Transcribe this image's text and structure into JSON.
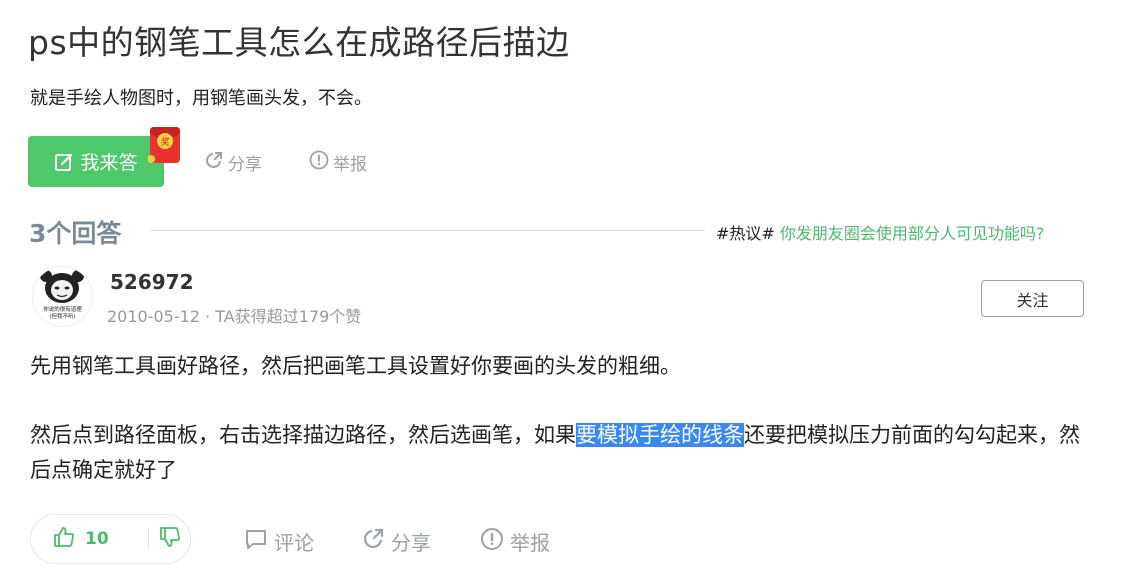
{
  "question": {
    "title": "ps中的钢笔工具怎么在成路径后描边",
    "description": "就是手绘人物图时，用钢笔画头发，不会。",
    "answer_button": "我来答",
    "share": "分享",
    "report": "举报",
    "redpack_char": "奖"
  },
  "answers_header": {
    "count": "3个回答",
    "hot_tag": "#热议#",
    "hot_link": "你发朋友圈会使用部分人可见功能吗?"
  },
  "answer": {
    "username": "526972",
    "meta": "2010-05-12 · TA获得超过179个赞",
    "avatar_caption_1": "你说的很有道理",
    "avatar_caption_2": "(但我不听)",
    "follow": "关注",
    "para1": "先用钢笔工具画好路径，然后把画笔工具设置好你要画的头发的粗细。",
    "para2_before": "然后点到路径面板，右击选择描边路径，然后选画笔，如果",
    "para2_highlight": "要模拟手绘的线条",
    "para2_after": "还要把模拟压力前面的勾勾起来，然后点确定就好了",
    "likes": "10",
    "comment": "评论",
    "share": "分享",
    "report": "举报"
  },
  "colors": {
    "accent_green": "#4dc86a",
    "link_green": "#4dba6b",
    "highlight_blue": "#3b88f5",
    "muted_gray": "#9aa1a7"
  },
  "icons": [
    "edit-icon",
    "share-icon",
    "report-icon",
    "thumbs-up-icon",
    "thumbs-down-icon",
    "comment-icon",
    "redpack-icon",
    "avatar-panda-meme"
  ]
}
